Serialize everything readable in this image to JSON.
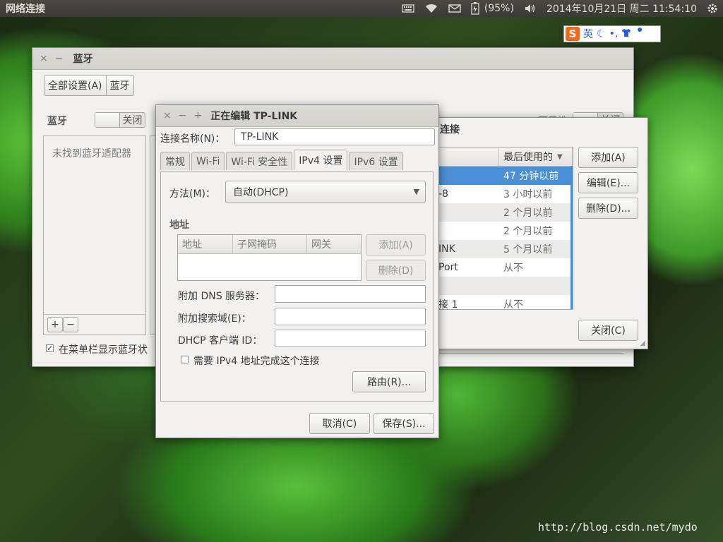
{
  "topbar": {
    "app_title": "网络连接",
    "battery": "(95%)",
    "datetime": "2014年10月21日 周二 11:54:10",
    "icons": [
      "keyboard-icon",
      "wifi-icon",
      "mail-icon",
      "battery-icon",
      "volume-icon",
      "gear-icon"
    ]
  },
  "ime": {
    "logo": "S",
    "lang": "英",
    "icons": [
      "moon-icon",
      "punctuation-icon",
      "shirt-icon",
      "wrench-icon"
    ]
  },
  "bluetooth_window": {
    "title": "蓝牙",
    "breadcrumb": [
      "全部设置(A)",
      "蓝牙"
    ],
    "section_label": "蓝牙",
    "toggle_off": "关闭",
    "no_adapter": "未找到蓝牙适配器",
    "add": "+",
    "remove": "−",
    "show_in_menu": "在菜单栏显示蓝牙状",
    "visible_label": "可见性",
    "visible_toggle": "关闭"
  },
  "network_window": {
    "title": "连接",
    "col_last_used": "最后使用的",
    "rows": [
      {
        "name": "",
        "time": "47 分钟以前",
        "selected": true
      },
      {
        "name": "-8",
        "time": "3 小时以前"
      },
      {
        "name": "",
        "time": "2 个月以前"
      },
      {
        "name": "",
        "time": "2 个月以前"
      },
      {
        "name": "INK",
        "time": "5 个月以前"
      },
      {
        "name": "Port",
        "time": "从不"
      },
      {
        "name": "",
        "time": ""
      },
      {
        "name": "接 1",
        "time": "从不"
      }
    ],
    "add": "添加(A)",
    "edit": "编辑(E)...",
    "delete": "删除(D)...",
    "close": "关闭(C)"
  },
  "edit_window": {
    "title": "正在编辑 TP-LINK",
    "conn_name_label": "连接名称(N)：",
    "conn_name_value": "TP-LINK",
    "tabs": [
      "常规",
      "Wi-Fi",
      "Wi-Fi 安全性",
      "IPv4 设置",
      "IPv6 设置"
    ],
    "active_tab": 3,
    "method_label": "方法(M)：",
    "method_value": "自动(DHCP)",
    "address_section": "地址",
    "table_headers": [
      "地址",
      "子网掩码",
      "网关"
    ],
    "add": "添加(A)",
    "delete": "删除(D)",
    "dns_label": "附加 DNS 服务器：",
    "search_label": "附加搜索域(E)：",
    "dhcp_label": "DHCP 客户端 ID：",
    "dns_value": "",
    "search_value": "",
    "dhcp_value": "",
    "require_ipv4": "需要 IPv4 地址完成这个连接",
    "routes": "路由(R)...",
    "cancel": "取消(C)",
    "save": "保存(S)..."
  },
  "watermark": "http://blog.csdn.net/mydo"
}
